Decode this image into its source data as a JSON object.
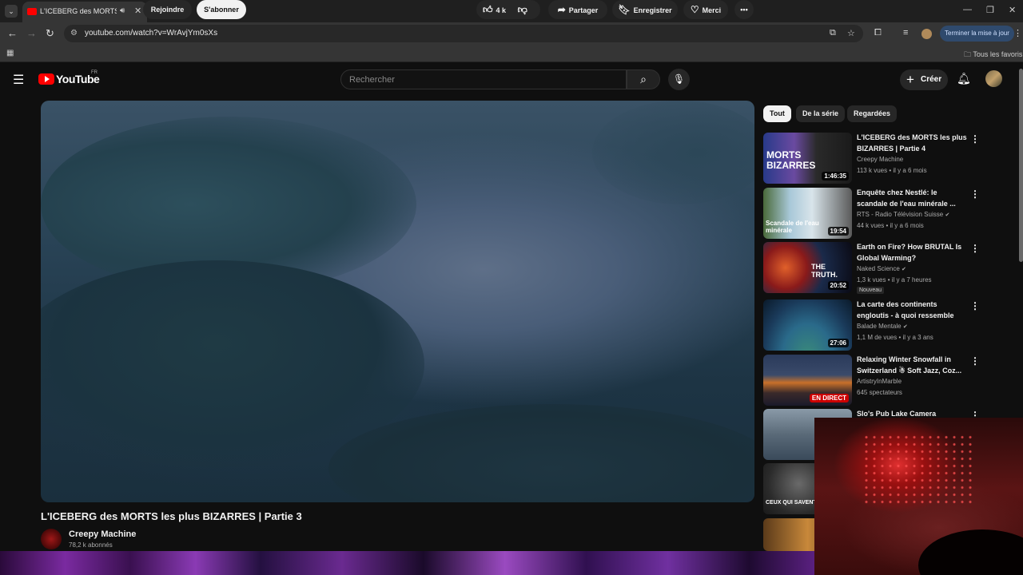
{
  "browser": {
    "tab_title": "L'ICEBERG des MORTS les p",
    "url": "youtube.com/watch?v=WrAvjYm0sXs",
    "update_button": "Terminer la mise à jour",
    "bookmarks_all": "Tous les favoris"
  },
  "header": {
    "logo_text": "YouTube",
    "logo_region": "FR",
    "search_placeholder": "Rechercher",
    "create_label": "Créer"
  },
  "video": {
    "title": "L'ICEBERG des MORTS les plus BIZARRES | Partie 3",
    "channel_name": "Creepy Machine",
    "subscribers": "78,2 k abonnés",
    "join_label": "Rejoindre",
    "subscribe_label": "S'abonner",
    "likes": "4 k",
    "share_label": "Partager",
    "save_label": "Enregistrer",
    "thanks_label": "Merci"
  },
  "chips": [
    "Tout",
    "De la série",
    "Regardées"
  ],
  "recommendations": [
    {
      "title": "L'ICEBERG des MORTS les plus BIZARRES | Partie 4",
      "channel": "Creepy Machine",
      "meta": "113 k vues • il y a 6 mois",
      "duration": "1:46:35",
      "badge": "",
      "verified": false,
      "thumb_text": "MORTS BIZARRES"
    },
    {
      "title": "Enquête chez Nestlé: le scandale de l'eau minérale ...",
      "channel": "RTS - Radio Télévision Suisse",
      "meta": "44 k vues • il y a 6 mois",
      "duration": "19:54",
      "badge": "",
      "verified": true,
      "thumb_text": "Scandale de l'eau minérale"
    },
    {
      "title": "Earth on Fire? How BRUTAL Is Global Warming?",
      "channel": "Naked Science",
      "meta": "1,3 k vues • il y a 7 heures",
      "duration": "20:52",
      "badge": "Nouveau",
      "verified": true,
      "thumb_text": "THE TRUTH."
    },
    {
      "title": "La carte des continents engloutis - à quoi ressemble la...",
      "channel": "Balade Mentale",
      "meta": "1,1 M de vues • il y a 3 ans",
      "duration": "27:06",
      "badge": "",
      "verified": true,
      "thumb_text": ""
    },
    {
      "title": "Relaxing Winter Snowfall in Switzerland ☃ Soft Jazz, Coz...",
      "channel": "ArtistryInMarble",
      "meta": "645 spectateurs",
      "duration": "EN DIRECT",
      "badge": "",
      "verified": false,
      "thumb_text": ""
    },
    {
      "title": "Slo's Pub Lake Camera",
      "channel": "",
      "meta": "",
      "duration": "",
      "badge": "",
      "verified": false,
      "thumb_text": ""
    }
  ],
  "extra_thumbs": [
    "CEUX QUI SAVENT..."
  ],
  "colors": {
    "accent": "#ff0000",
    "background": "#0f0f0f",
    "live": "#cc0000"
  }
}
